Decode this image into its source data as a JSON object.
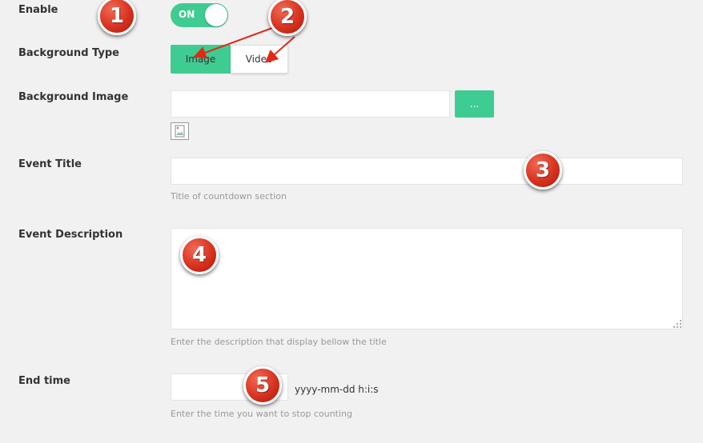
{
  "labels": {
    "enable": "Enable",
    "background_type": "Background Type",
    "background_image": "Background Image",
    "event_title": "Event Title",
    "event_description": "Event Description",
    "end_time": "End time"
  },
  "toggle": {
    "label": "ON",
    "state": "on"
  },
  "background_type": {
    "options": [
      "Image",
      "Video"
    ],
    "selected": "Image"
  },
  "background_image": {
    "value": "",
    "browse_label": "..."
  },
  "event_title": {
    "value": "",
    "help": "Title of countdown section"
  },
  "event_description": {
    "value": "",
    "help": "Enter the description that display bellow the title"
  },
  "end_time": {
    "value": "",
    "format": "yyyy-mm-dd h:i:s",
    "help": "Enter the time you want to stop counting"
  },
  "badges": [
    "1",
    "2",
    "3",
    "4",
    "5"
  ],
  "colors": {
    "accent": "#3fcc92",
    "badge": "#d8321f",
    "background": "#f1f1f1"
  }
}
